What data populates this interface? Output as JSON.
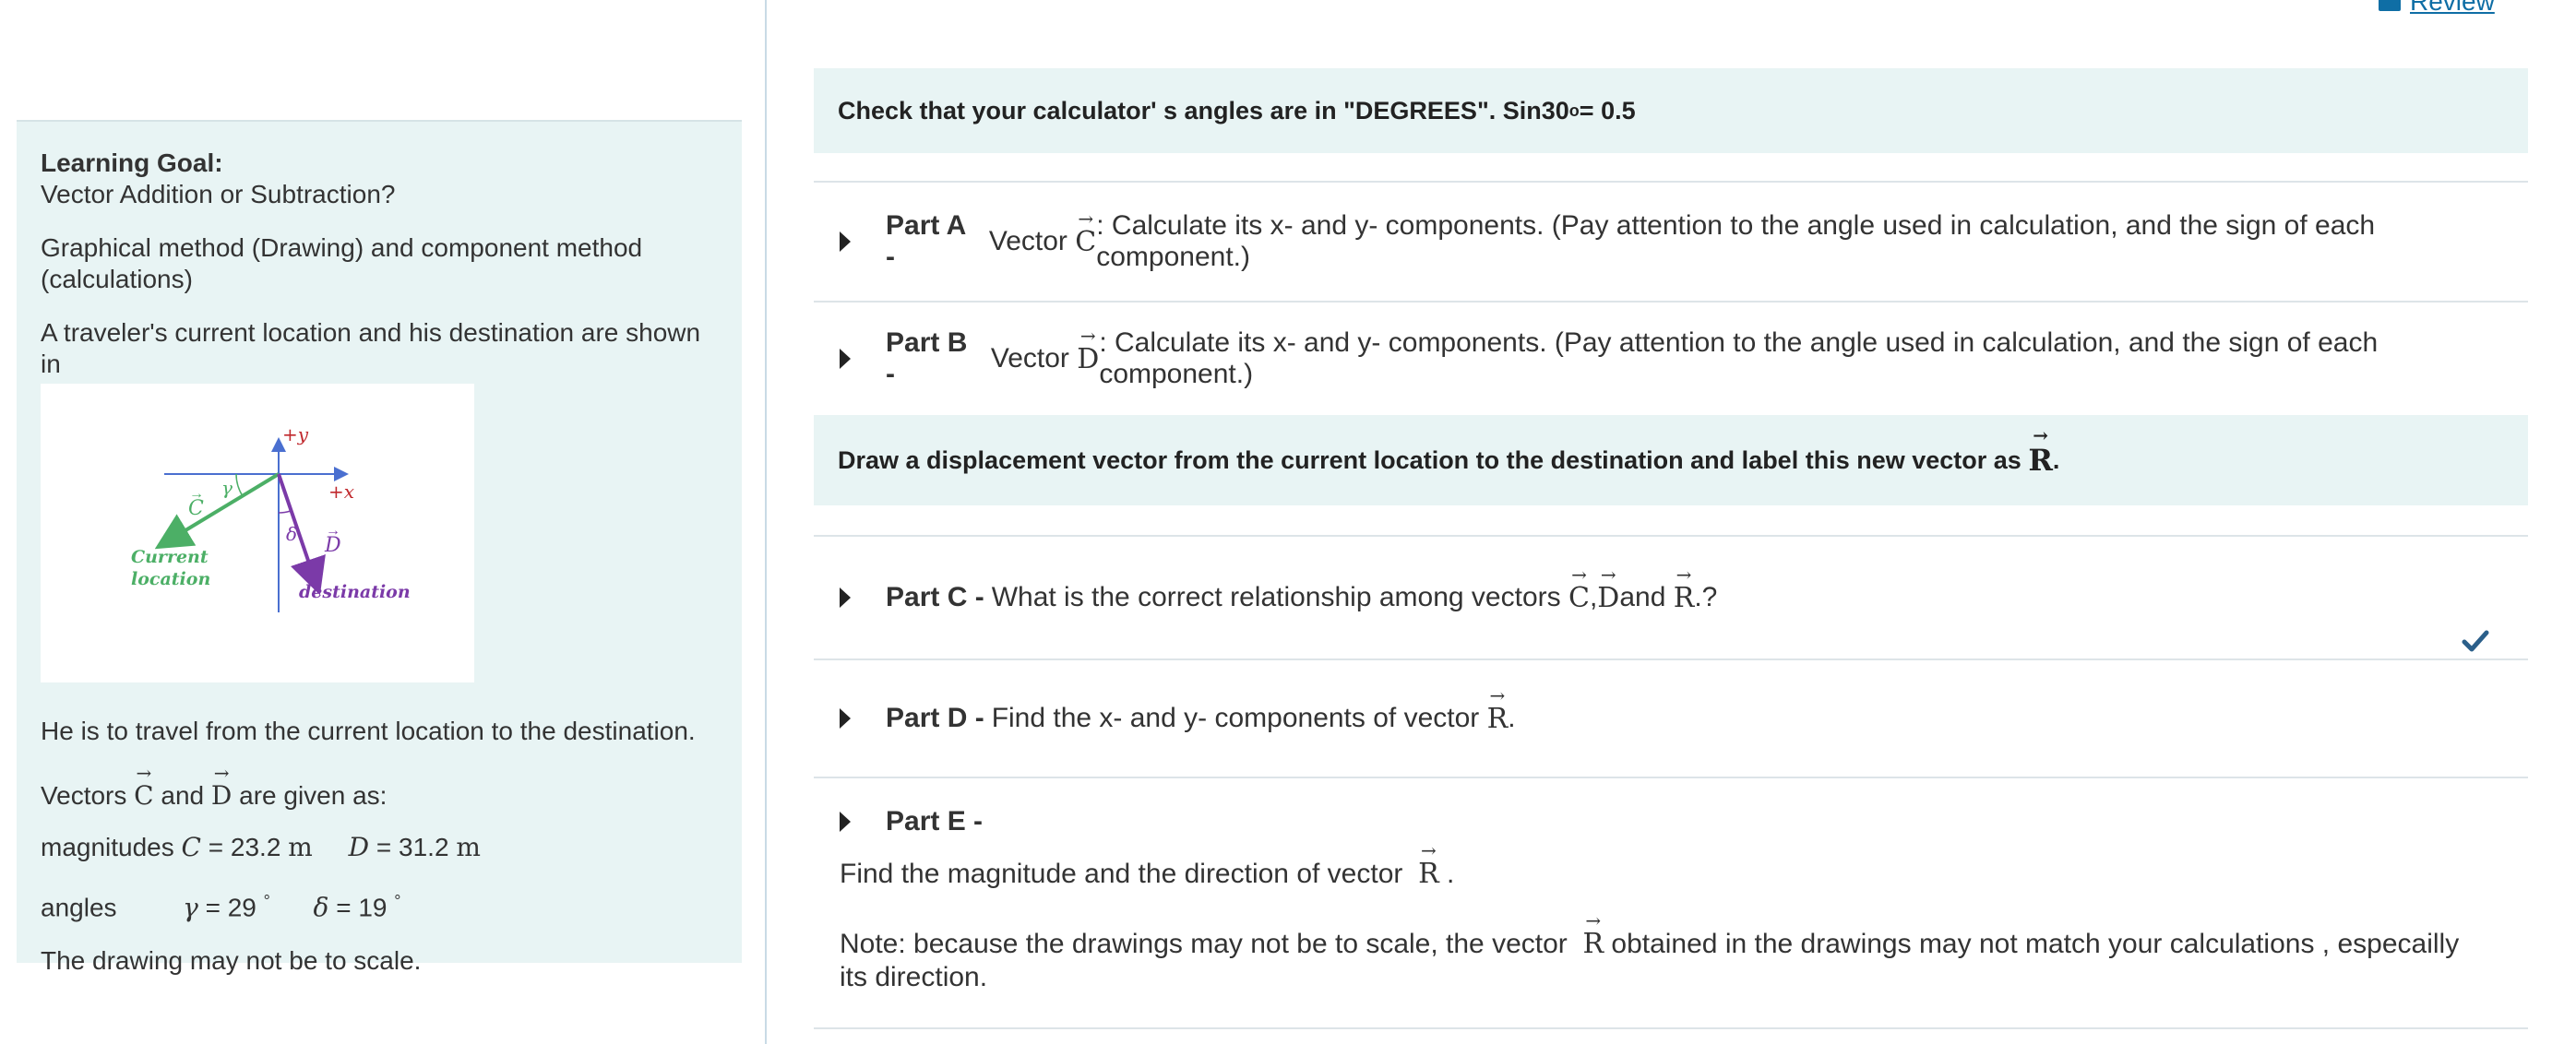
{
  "header": {
    "review_link": "Review"
  },
  "left": {
    "goal_title": "Learning Goal:",
    "goal_text": "Vector Addition or Subtraction?",
    "methods": "Graphical method (Drawing)  and component method (calculations)",
    "intro": "A traveler's current location and his destination are shown in",
    "figure": {
      "plus_y": "+y",
      "plus_x": "+x",
      "gamma": "γ",
      "delta": "δ",
      "c_label": "C",
      "d_label": "D",
      "current_line1": "Current",
      "current_line2": "location",
      "destination": "destination"
    },
    "travel": "He is to travel from the current location to the destination.",
    "vectors_prefix": "Vectors",
    "vectors_c": "C",
    "vectors_and": "and",
    "vectors_d": "D",
    "vectors_suffix": "are given as:",
    "magnitudes_label": "magnitudes",
    "mag_c_sym": "C",
    "mag_c_val": "= 23.2",
    "mag_c_unit": "m",
    "mag_d_sym": "D",
    "mag_d_val": "= 31.2",
    "mag_d_unit": "m",
    "angles_label": "angles",
    "gamma_sym": "γ",
    "gamma_val": "= 29",
    "delta_sym": "δ",
    "delta_val": "= 19",
    "deg": "°",
    "scale_note": "The drawing may not be to scale."
  },
  "right": {
    "info1_main": "Check that your calculator' s angles are in \"DEGREES\". Sin30",
    "info1_sup": "o",
    "info1_tail": " = 0.5",
    "info2_main": "Draw a displacement vector from the current location to the destination and label this new vector as ",
    "info2_vec": "R",
    "info2_tail": ".",
    "partA": {
      "label": "Part A -",
      "pre": "Vector ",
      "vec": "C",
      "post": ": Calculate its x- and y- components. (Pay attention to the angle used in calculation, and the sign of each component.)"
    },
    "partB": {
      "label": "Part B -",
      "pre": "Vector ",
      "vec": "D",
      "post": ": Calculate its x- and y- components. (Pay attention to the angle used in calculation, and the sign of each component.)"
    },
    "partC": {
      "label": "Part C -",
      "pre": "What is the correct relationship among vectors ",
      "v1": "C",
      "sep": ", ",
      "v2": "D",
      "and": " and ",
      "v3": "R",
      "post": ".?"
    },
    "partD": {
      "label": "Part D -",
      "pre": "Find the  x- and y- components of vector ",
      "vec": "R",
      "post": " ."
    },
    "partE": {
      "label": "Part E -",
      "line1_pre": "Find the magnitude and the direction of vector ",
      "line1_vec": "R",
      "line1_post": " .",
      "note_pre": "Note: because the drawings may not be to scale, the vector ",
      "note_vec": "R",
      "note_post": "  obtained in the drawings may not match your calculations , especailly its direction."
    }
  },
  "colors": {
    "panel_bg": "#e8f4f4",
    "link": "#0f6ea5",
    "vector_c": "#4caf66",
    "vector_d": "#7b3aa8",
    "axis": "#4a6fd0",
    "axis_label": "#c0282d",
    "check": "#2b5f8a"
  },
  "icons": {
    "review": "book-icon",
    "expand": "triangle-right-icon",
    "complete": "checkmark-icon"
  }
}
